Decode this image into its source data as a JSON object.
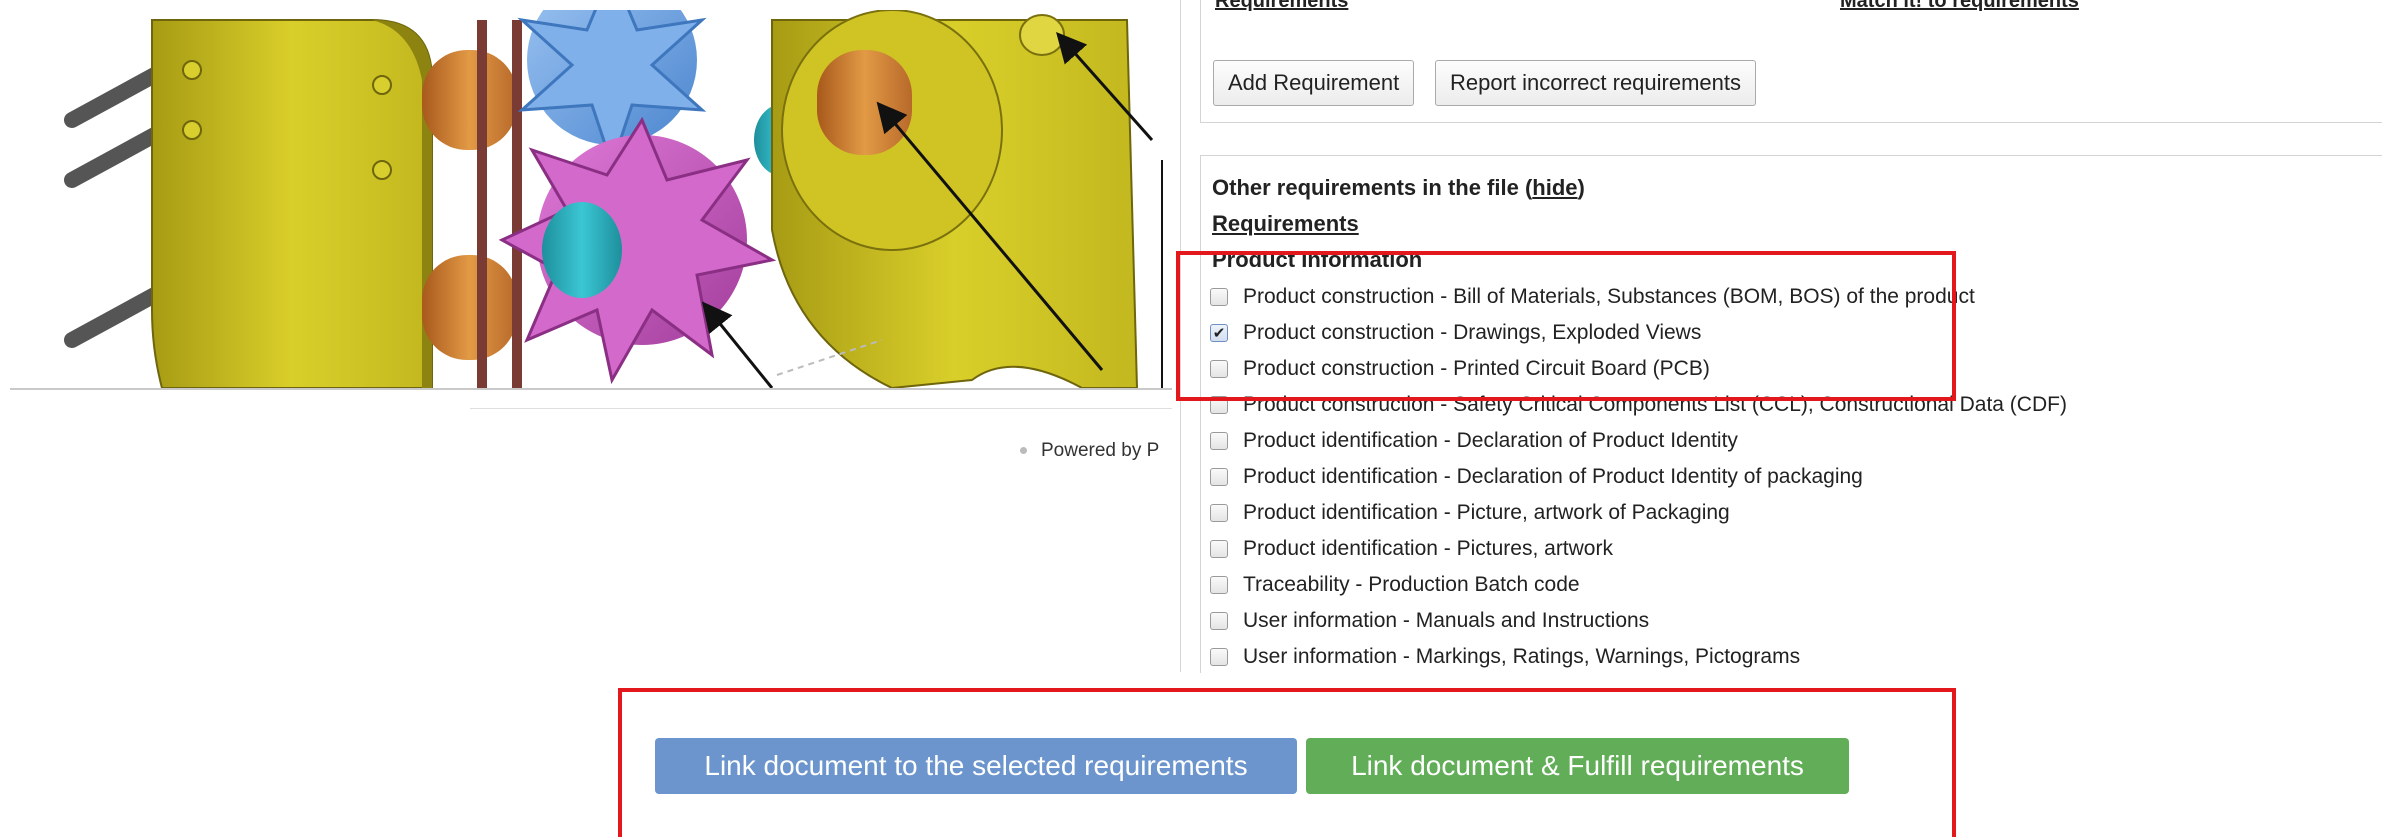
{
  "viewer": {
    "powered_by": "Powered by P"
  },
  "requirements_section": {
    "header_left": "Requirements",
    "header_right": "Match it!   to requirements",
    "add_button": "Add Requirement",
    "report_button": "Report incorrect requirements"
  },
  "other_section": {
    "title": "Other requirements in the file (",
    "hide_link": "hide",
    "title_end": ")",
    "requirements_heading": "Requirements",
    "group_heading": "Product Information",
    "items": [
      {
        "label": "Product construction - Bill of Materials, Substances (BOM, BOS) of the product",
        "checked": false
      },
      {
        "label": "Product construction - Drawings, Exploded Views",
        "checked": true
      },
      {
        "label": "Product construction - Printed Circuit Board (PCB)",
        "checked": false
      },
      {
        "label": "Product construction - Safety Critical Components List (CCL), Constructional Data (CDF)",
        "checked": false
      },
      {
        "label": "Product identification - Declaration of Product Identity",
        "checked": false
      },
      {
        "label": "Product identification - Declaration of Product Identity of packaging",
        "checked": false
      },
      {
        "label": "Product identification - Picture, artwork of Packaging",
        "checked": false
      },
      {
        "label": "Product identification - Pictures, artwork",
        "checked": false
      },
      {
        "label": "Traceability - Production Batch code",
        "checked": false
      },
      {
        "label": "User information - Manuals and Instructions",
        "checked": false
      },
      {
        "label": "User information - Markings, Ratings, Warnings, Pictograms",
        "checked": false
      }
    ]
  },
  "actions": {
    "link_button": "Link document to the selected requirements",
    "fulfill_button": "Link document & Fulfill requirements"
  },
  "colors": {
    "link_button": "#6b95cc",
    "fulfill_button": "#62ad57",
    "highlight": "#e3181c"
  }
}
